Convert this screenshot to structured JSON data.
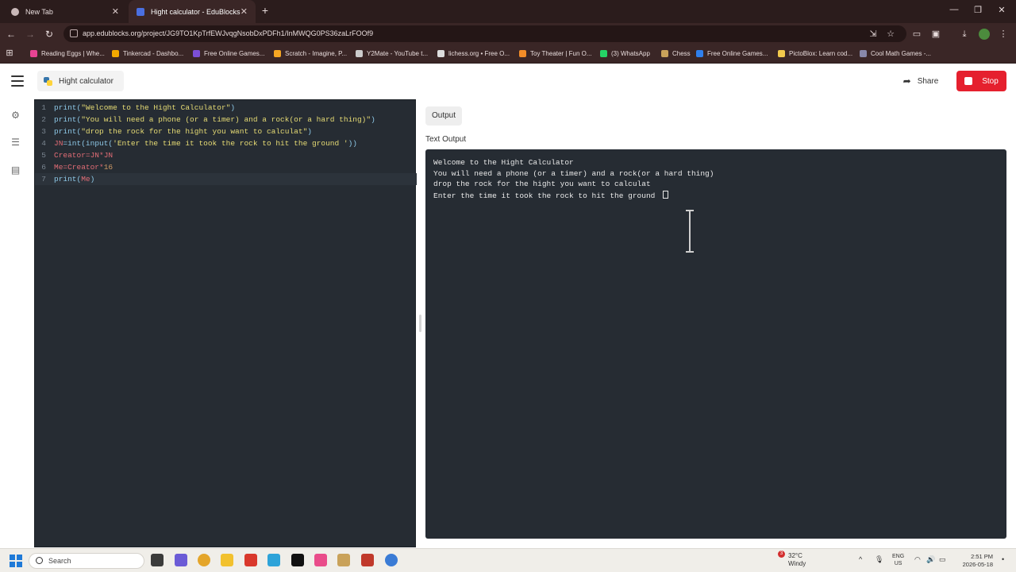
{
  "browser": {
    "tabs": [
      {
        "label": "New Tab",
        "active": false
      },
      {
        "label": "Hight calculator - EduBlocks",
        "active": true
      }
    ],
    "url": "app.edublocks.org/project/JG9TO1KpTrfEWJvqgNsobDxPDFh1/InMWQG0PS36zaLrFOOf9",
    "bookmarks": [
      {
        "label": "Reading Eggs | Whe...",
        "color": "#e84393"
      },
      {
        "label": "Tinkercad - Dashbo...",
        "color": "#f2a900"
      },
      {
        "label": "Free Online Games...",
        "color": "#7b4fd6"
      },
      {
        "label": "Scratch - Imagine, P...",
        "color": "#f5a623"
      },
      {
        "label": "Y2Mate - YouTube t...",
        "color": "#cccccc"
      },
      {
        "label": "lichess.org • Free O...",
        "color": "#dddddd"
      },
      {
        "label": "Toy Theater | Fun O...",
        "color": "#f28c28"
      },
      {
        "label": "(3) WhatsApp",
        "color": "#25d366"
      },
      {
        "label": "Chess",
        "color": "#c9a25a"
      },
      {
        "label": "Free Online Games...",
        "color": "#2f80ed"
      },
      {
        "label": "PictoBlox: Learn cod...",
        "color": "#f2c94c"
      },
      {
        "label": "Cool Math Games -...",
        "color": "#8888aa"
      }
    ]
  },
  "app": {
    "project_name": "Hight calculator",
    "share_label": "Share",
    "stop_label": "Stop"
  },
  "editor": {
    "lines": [
      {
        "num": "1",
        "parts": [
          {
            "t": "print(",
            "c": "k"
          },
          {
            "t": "\"Welcome to the Hight Calculator\"",
            "c": "s"
          },
          {
            "t": ")",
            "c": "k"
          }
        ]
      },
      {
        "num": "2",
        "parts": [
          {
            "t": "print(",
            "c": "k"
          },
          {
            "t": "\"You will need a phone (or a timer) and a rock(or a hard thing)\"",
            "c": "s"
          },
          {
            "t": ")",
            "c": "k"
          }
        ]
      },
      {
        "num": "3",
        "parts": [
          {
            "t": "print(",
            "c": "k"
          },
          {
            "t": "\"drop the rock for the hight you want to calculat\"",
            "c": "s"
          },
          {
            "t": ")",
            "c": "k"
          }
        ]
      },
      {
        "num": "4",
        "parts": [
          {
            "t": "JN",
            "c": "v"
          },
          {
            "t": "=int(input(",
            "c": "k"
          },
          {
            "t": "'Enter the time it took the rock to hit the ground '",
            "c": "s"
          },
          {
            "t": "))",
            "c": "k"
          }
        ]
      },
      {
        "num": "5",
        "parts": [
          {
            "t": "Creator=JN*JN",
            "c": "v"
          }
        ]
      },
      {
        "num": "6",
        "parts": [
          {
            "t": "Me=Creator*",
            "c": "v"
          },
          {
            "t": "16",
            "c": "n"
          }
        ]
      },
      {
        "num": "7",
        "parts": [
          {
            "t": "print(",
            "c": "k"
          },
          {
            "t": "Me",
            "c": "v"
          },
          {
            "t": ")",
            "c": "k"
          }
        ]
      }
    ]
  },
  "output": {
    "tab_label": "Output",
    "section_label": "Text Output",
    "lines": [
      "Welcome to the Hight Calculator",
      "You will need a phone (or a timer) and a rock(or a hard thing)",
      "drop the rock for the hight you want to calculat",
      "Enter the time it took the rock to hit the ground "
    ]
  },
  "taskbar": {
    "search_placeholder": "Search",
    "weather_temp": "32°C",
    "weather_desc": "Windy",
    "weather_badge": "3",
    "lang_top": "ENG",
    "lang_bottom": "US",
    "time": "2:51 PM",
    "date": "2026-05-18"
  }
}
